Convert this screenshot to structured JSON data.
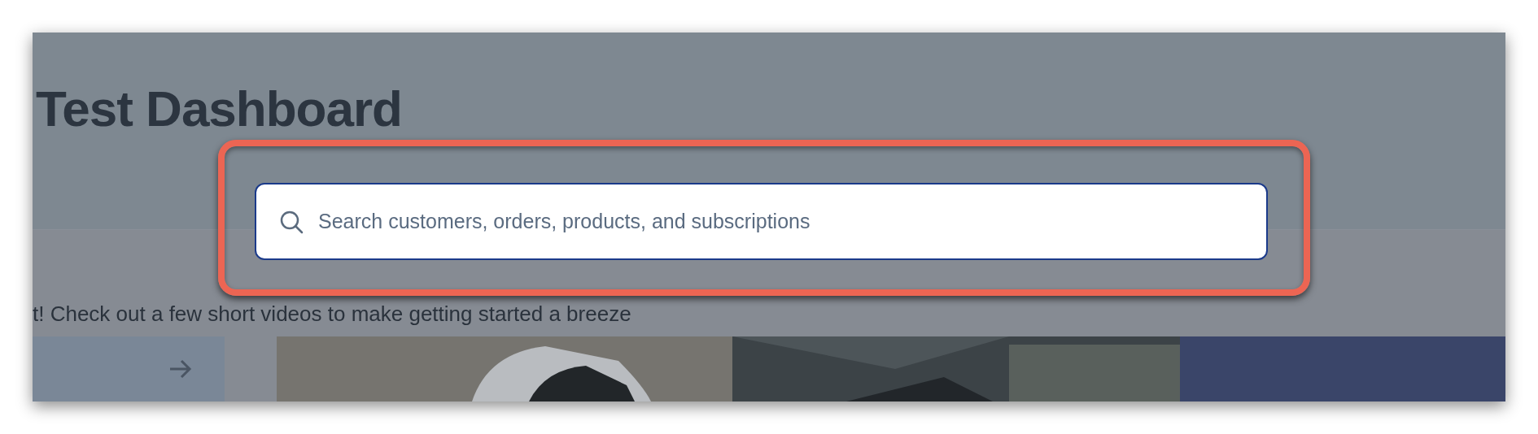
{
  "page": {
    "title": "Test Dashboard",
    "intro": "t! Check out a few short videos to make getting started a breeze"
  },
  "search": {
    "placeholder": "Search customers, orders, products, and subscriptions"
  }
}
